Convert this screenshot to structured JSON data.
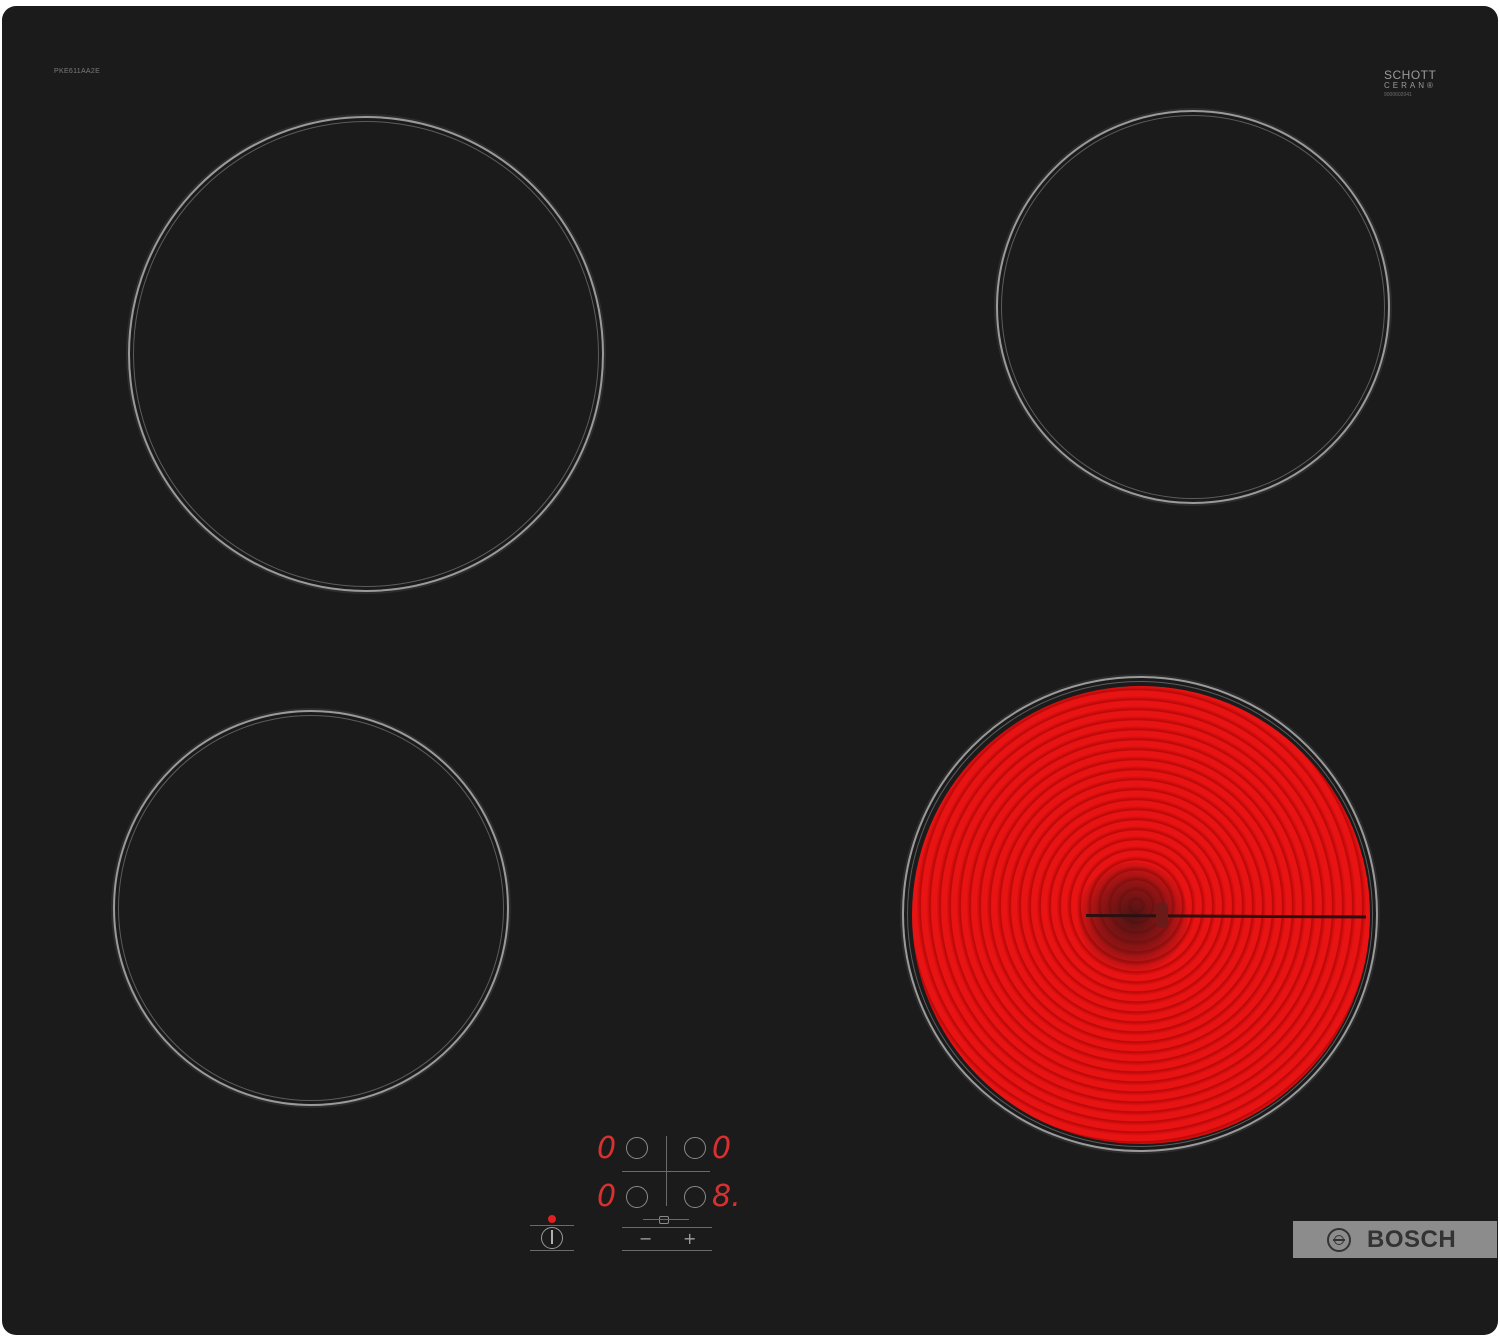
{
  "cooktop": {
    "model_code": "PKE611AA2E",
    "glass_brand_line1": "SCHOTT",
    "glass_brand_line2": "CERAN®",
    "glass_code": "9000602041"
  },
  "zones": [
    {
      "name": "rear-left",
      "state": "off"
    },
    {
      "name": "rear-right",
      "state": "off"
    },
    {
      "name": "front-left",
      "state": "off"
    },
    {
      "name": "front-right",
      "state": "on"
    }
  ],
  "control_panel": {
    "displays": {
      "rear_left": "0",
      "rear_right": "0",
      "front_left": "0",
      "front_right": "8."
    },
    "minus_label": "−",
    "plus_label": "+"
  },
  "brand": {
    "name": "BOSCH"
  },
  "colors": {
    "glass": "#1b1b1b",
    "zone_ring": "#9a9a9a",
    "heating_red": "#e81414",
    "display_red": "#d83030",
    "brand_plate": "#8c8c8c"
  }
}
